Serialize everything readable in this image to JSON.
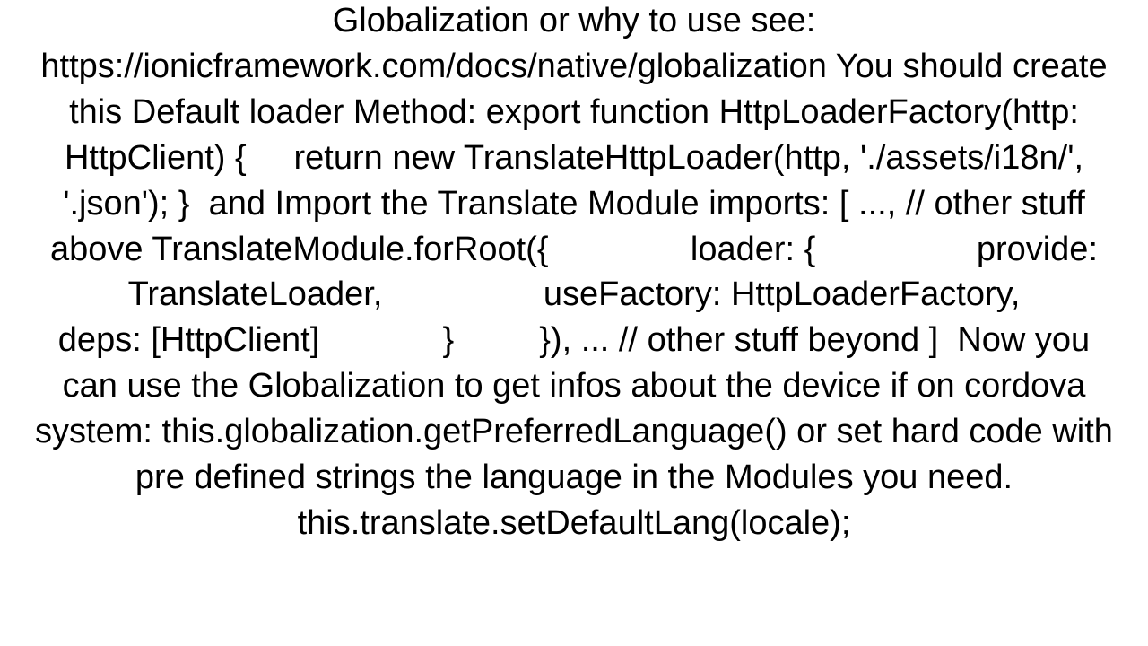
{
  "document": {
    "body_text": "Globalization or why to use see: https://ionicframework.com/docs/native/globalization You should create this Default loader Method: export function HttpLoaderFactory(http: HttpClient) {     return new TranslateHttpLoader(http, './assets/i18n/', '.json'); }  and Import the Translate Module imports: [ ..., // other stuff above TranslateModule.forRoot({               loader: {                 provide: TranslateLoader,                 useFactory: HttpLoaderFactory,                 deps: [HttpClient]             }         }), ... // other stuff beyond ]  Now you can use the Globalization to get infos about the device if on cordova system: this.globalization.getPreferredLanguage() or set hard code with pre defined strings the language in the Modules you need. this.translate.setDefaultLang(locale);"
  }
}
